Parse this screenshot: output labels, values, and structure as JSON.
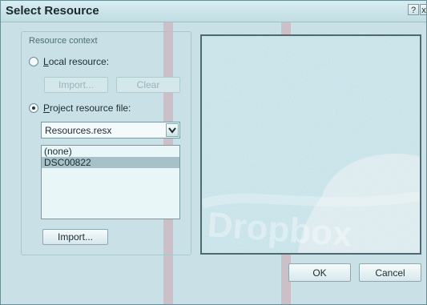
{
  "window": {
    "title": "Select Resource",
    "help_glyph": "?",
    "close_glyph": "x"
  },
  "context": {
    "group_label": "Resource context",
    "local_resource": {
      "label_key": "L",
      "label_rest": "ocal resource:",
      "selected": false
    },
    "local_import": "Import...",
    "local_clear": "Clear",
    "project_resource": {
      "label_key": "P",
      "label_rest": "roject resource file:",
      "selected": true
    },
    "resource_file": {
      "value": "Resources.resx",
      "dropdown_icon": "chevron-down-icon"
    },
    "resources": [
      {
        "name": "(none)",
        "selected": false
      },
      {
        "name": "DSC00822",
        "selected": true
      }
    ],
    "import_button": "Import..."
  },
  "preview": {
    "watermark": "Dropbox"
  },
  "footer": {
    "ok": "OK",
    "cancel": "Cancel"
  },
  "colors": {
    "dialog_bg": "#c9e1e6",
    "selection": "#a6c2c8",
    "preview_frame": "#4d6a70"
  }
}
